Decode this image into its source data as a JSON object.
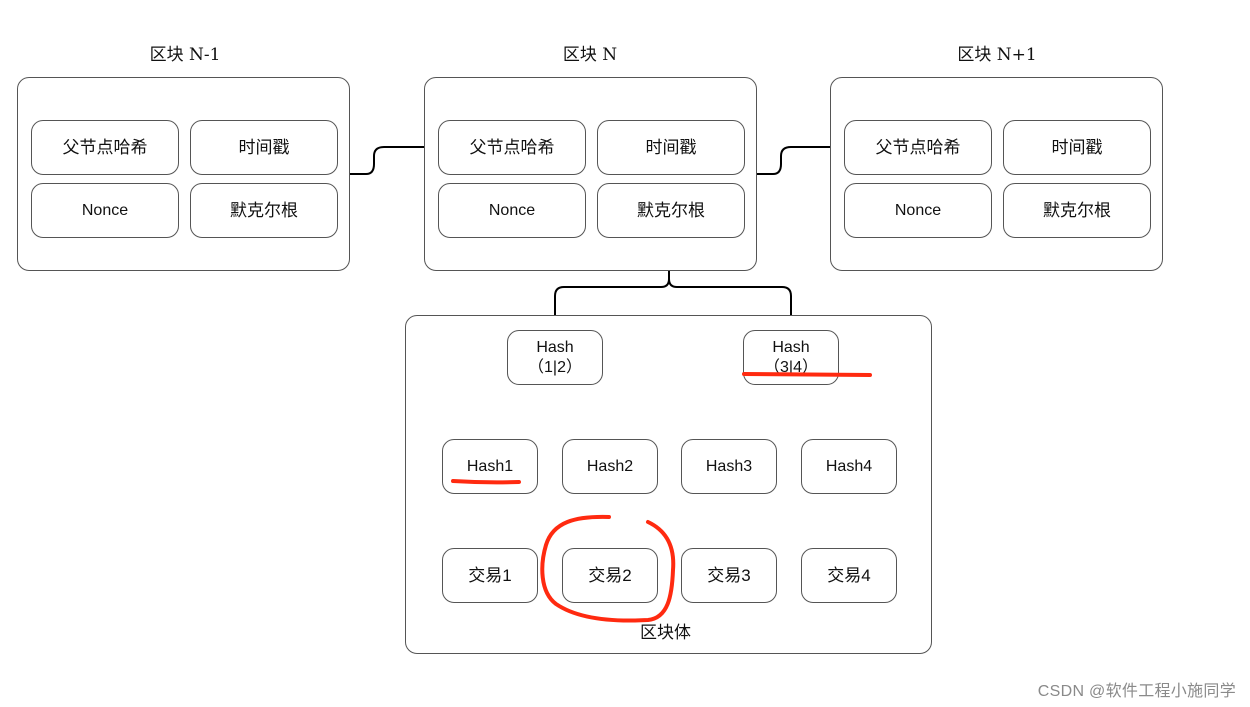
{
  "blocks": [
    {
      "title": "区块 N-1",
      "fields": [
        "父节点哈希",
        "时间戳",
        "Nonce",
        "默克尔根"
      ]
    },
    {
      "title": "区块 N",
      "fields": [
        "父节点哈希",
        "时间戳",
        "Nonce",
        "默克尔根"
      ]
    },
    {
      "title": "区块 N+1",
      "fields": [
        "父节点哈希",
        "时间戳",
        "Nonce",
        "默克尔根"
      ]
    }
  ],
  "merkle_tree": {
    "body_label": "区块体",
    "level2": [
      {
        "line1": "Hash",
        "line2": "（1|2）"
      },
      {
        "line1": "Hash",
        "line2": "（3|4）"
      }
    ],
    "level1": [
      "Hash1",
      "Hash2",
      "Hash3",
      "Hash4"
    ],
    "transactions": [
      "交易1",
      "交易2",
      "交易3",
      "交易4"
    ]
  },
  "annotations": {
    "color": "#ff2a10",
    "highlighted": [
      "Hash1",
      "交易2",
      "Hash（3|4）"
    ]
  },
  "watermark": "CSDN @软件工程小施同学"
}
